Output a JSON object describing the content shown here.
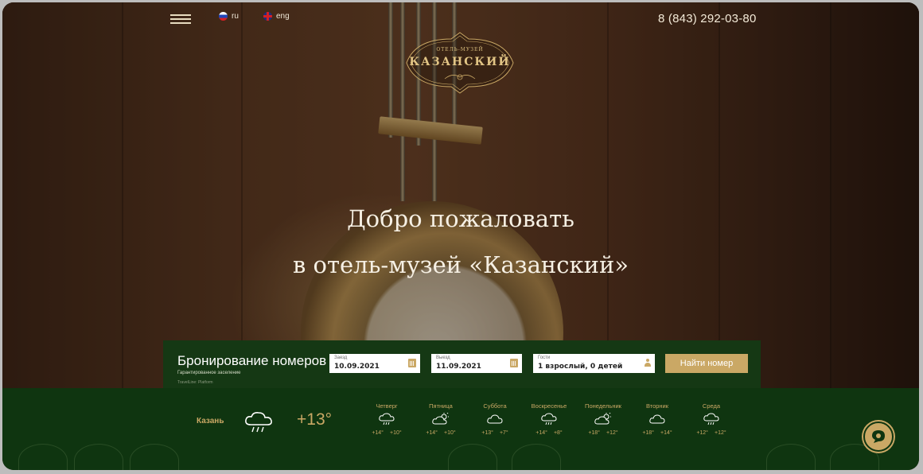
{
  "header": {
    "lang_ru": "ru",
    "lang_en": "eng",
    "phone": "8 (843) 292-03-80"
  },
  "logo": {
    "subtitle": "ОТЕЛЬ-МУЗЕЙ",
    "title": "КАЗАНСКИЙ"
  },
  "hero": {
    "line1": "Добро пожаловать",
    "line2": "в отель-музей «Казанский»"
  },
  "booking": {
    "title": "Бронирование номеров",
    "subtitle": "Гарантированное заселение",
    "provider": "TravelLine: Platform",
    "checkin_label": "Заезд",
    "checkin_value": "10.09.2021",
    "checkout_label": "Выезд",
    "checkout_value": "11.09.2021",
    "guests_label": "Гости",
    "guests_value": "1 взрослый, 0 детей",
    "find_button": "Найти номер"
  },
  "weather": {
    "city": "Казань",
    "current_icon": "rain-cloud-icon",
    "current_temp": "+13°",
    "days": [
      {
        "name": "Четверг",
        "icon": "rain-cloud-icon",
        "high": "+14°",
        "low": "+10°"
      },
      {
        "name": "Пятница",
        "icon": "partly-cloudy-icon",
        "high": "+14°",
        "low": "+10°"
      },
      {
        "name": "Суббота",
        "icon": "cloud-icon",
        "high": "+13°",
        "low": "+7°"
      },
      {
        "name": "Воскресенье",
        "icon": "rain-cloud-icon",
        "high": "+14°",
        "low": "+8°"
      },
      {
        "name": "Понедельник",
        "icon": "partly-cloudy-icon",
        "high": "+18°",
        "low": "+12°"
      },
      {
        "name": "Вторник",
        "icon": "cloud-icon",
        "high": "+18°",
        "low": "+14°"
      },
      {
        "name": "Среда",
        "icon": "rain-cloud-icon",
        "high": "+12°",
        "low": "+12°"
      }
    ]
  },
  "colors": {
    "gold": "#caa865",
    "dark_green": "#0f3510",
    "booking_green": "#153814"
  }
}
